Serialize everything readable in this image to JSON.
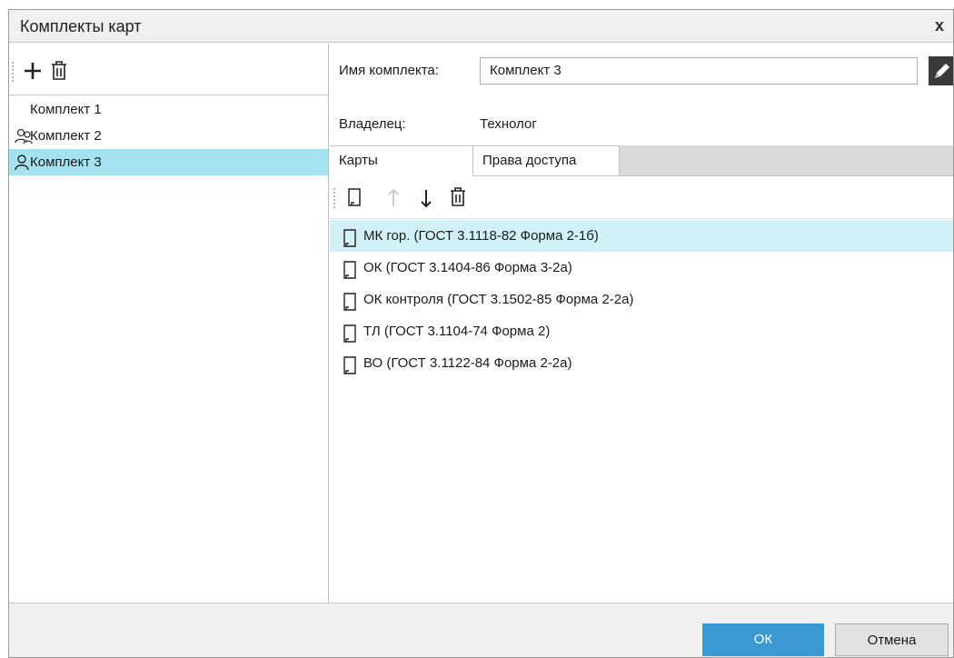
{
  "window": {
    "title": "Комплекты карт",
    "close_label": "x"
  },
  "left": {
    "items": [
      {
        "label": "Комплект 1",
        "icon": "none"
      },
      {
        "label": "Комплект 2",
        "icon": "users-icon"
      },
      {
        "label": "Комплект 3",
        "icon": "user-icon",
        "selected": true
      }
    ]
  },
  "details": {
    "name_label": "Имя комплекта:",
    "name_value": "Комплект 3",
    "owner_label": "Владелец:",
    "owner_value": "Технолог"
  },
  "tabs": [
    {
      "label": "Карты",
      "active": true
    },
    {
      "label": "Права доступа",
      "active": false
    }
  ],
  "cards": [
    {
      "label": "МК гор. (ГОСТ 3.1118-82 Форма 2-1б)",
      "selected": true
    },
    {
      "label": "ОК (ГОСТ 3.1404-86 Форма 3-2а)"
    },
    {
      "label": "ОК контроля (ГОСТ 3.1502-85 Форма 2-2а)"
    },
    {
      "label": "ТЛ (ГОСТ 3.1104-74 Форма 2)"
    },
    {
      "label": "ВО (ГОСТ 3.1122-84 Форма 2-2а)"
    }
  ],
  "footer": {
    "ok_label": "ОК",
    "cancel_label": "Отмена"
  },
  "colors": {
    "selection": "#a4e2ef",
    "row_selection": "#d2f1f6",
    "ok_button": "#3a98d2"
  }
}
